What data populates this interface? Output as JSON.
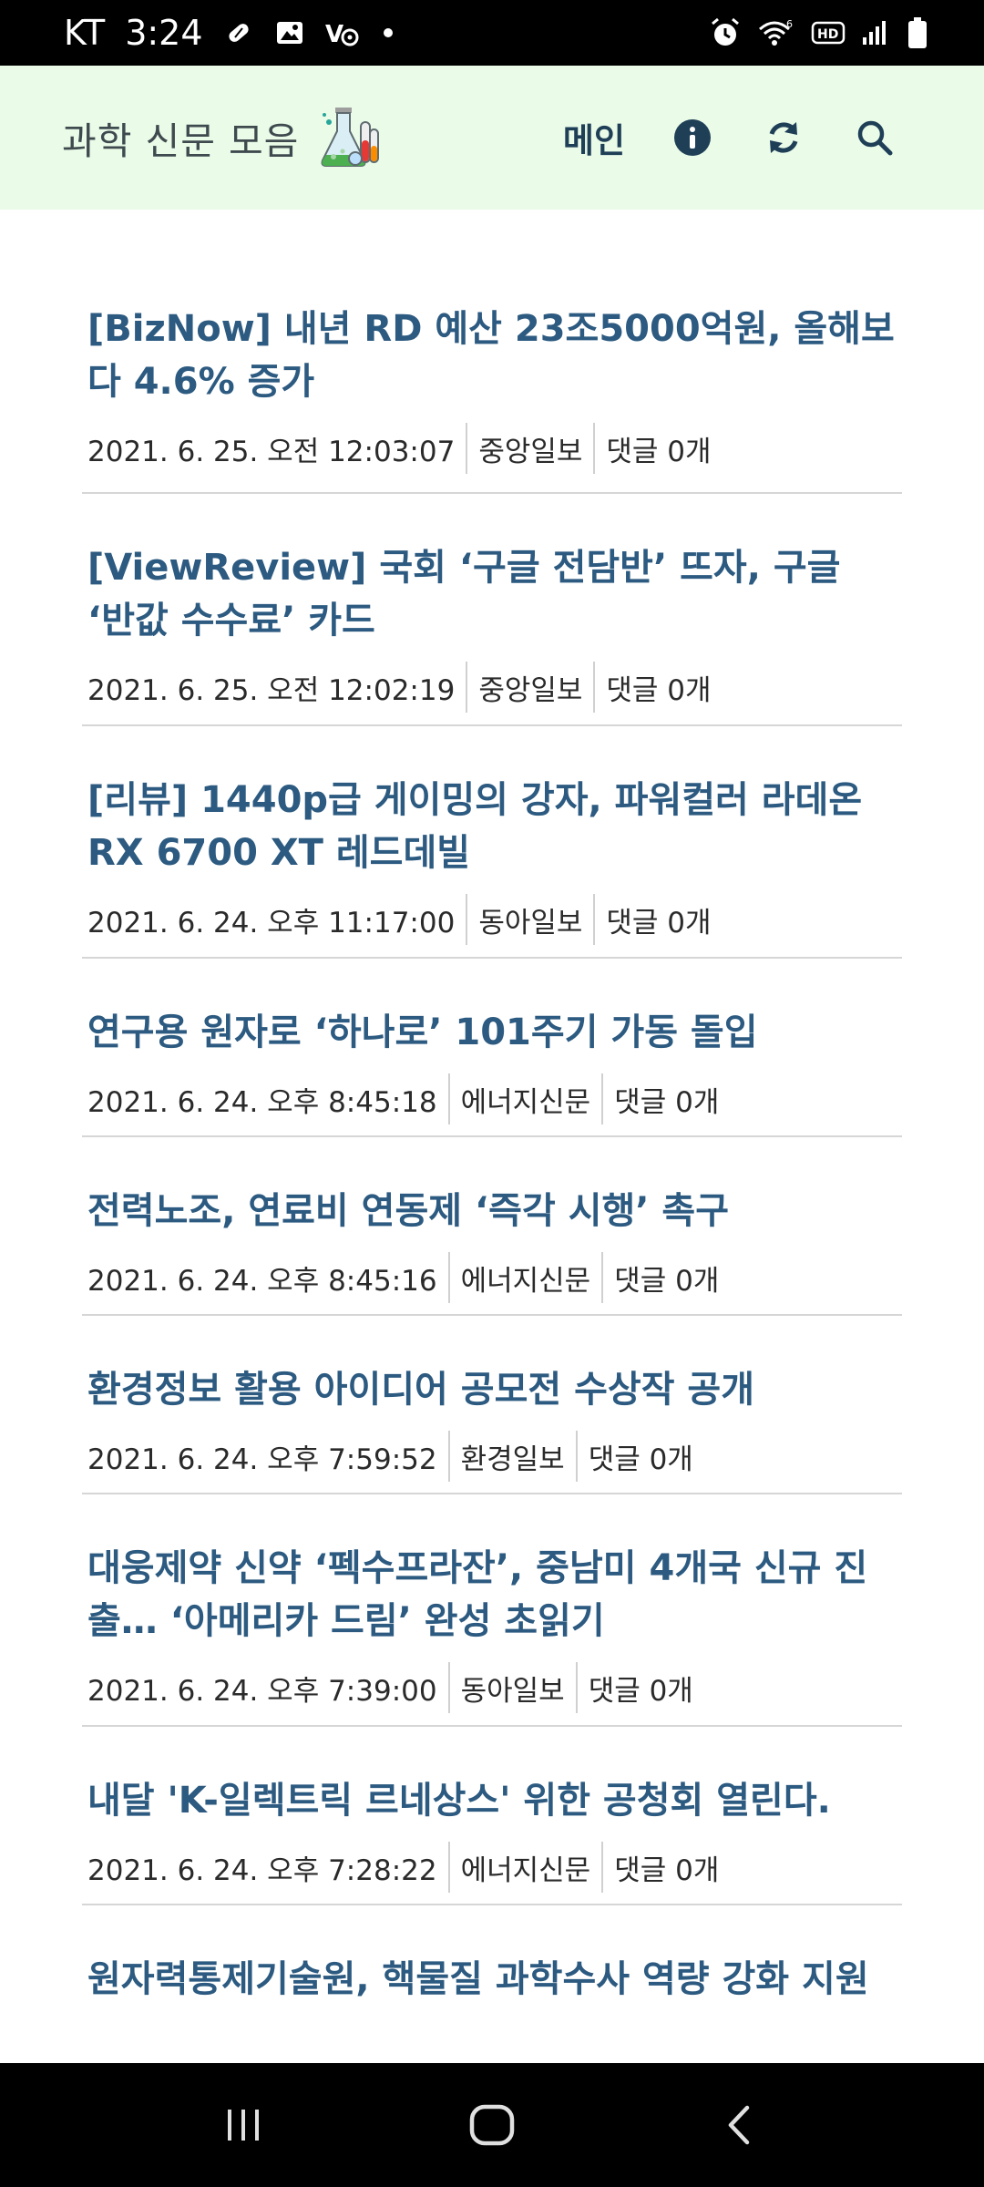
{
  "status_bar": {
    "carrier": "KT",
    "time": "3:24",
    "left_icons": [
      "pill-icon",
      "gallery-icon",
      "vpn-settings-icon",
      "dot-icon"
    ],
    "right_icons": [
      "alarm-icon",
      "wifi-6-icon",
      "hd-voice-icon",
      "signal-icon",
      "battery-icon"
    ]
  },
  "header": {
    "title": "과학 신문 모음",
    "logo_icon": "chemistry-flasks-icon",
    "menu_main": "메인",
    "actions": [
      "info-icon",
      "refresh-icon",
      "search-icon"
    ]
  },
  "colors": {
    "header_bg": "#eafbe8",
    "title_link": "#2c5a80",
    "menu_text": "#1f3f57",
    "divider": "#d6d6d6"
  },
  "news": [
    {
      "title": "[BizNow] 내년 RD 예산 23조5000억원, 올해보다 4.6% 증가",
      "date": "2021. 6. 25. 오전 12:03:07",
      "source": "중앙일보",
      "comments": "댓글 0개"
    },
    {
      "title": "[ViewReview] 국회 ‘구글 전담반’ 뜨자, 구글 ‘반값 수수료’ 카드",
      "date": "2021. 6. 25. 오전 12:02:19",
      "source": "중앙일보",
      "comments": "댓글 0개"
    },
    {
      "title": "[리뷰] 1440p급 게이밍의 강자, 파워컬러 라데온 RX 6700 XT 레드데빌",
      "date": "2021. 6. 24. 오후 11:17:00",
      "source": "동아일보",
      "comments": "댓글 0개"
    },
    {
      "title": "연구용 원자로 ‘하나로’ 101주기 가동 돌입",
      "date": "2021. 6. 24. 오후 8:45:18",
      "source": "에너지신문",
      "comments": "댓글 0개"
    },
    {
      "title": "전력노조, 연료비 연동제 ‘즉각 시행’ 촉구",
      "date": "2021. 6. 24. 오후 8:45:16",
      "source": "에너지신문",
      "comments": "댓글 0개"
    },
    {
      "title": "환경정보 활용 아이디어 공모전 수상작 공개",
      "date": "2021. 6. 24. 오후 7:59:52",
      "source": "환경일보",
      "comments": "댓글 0개"
    },
    {
      "title": "대웅제약 신약 ‘펙수프라잔’, 중남미 4개국 신규 진출… ‘아메리카 드림’ 완성 초읽기",
      "date": "2021. 6. 24. 오후 7:39:00",
      "source": "동아일보",
      "comments": "댓글 0개"
    },
    {
      "title": "내달 'K-일렉트릭 르네상스' 위한 공청회 열린다.",
      "date": "2021. 6. 24. 오후 7:28:22",
      "source": "에너지신문",
      "comments": "댓글 0개"
    },
    {
      "title": "원자력통제기술원, 핵물질 과학수사 역량 강화 지원"
    }
  ],
  "nav_bar": {
    "buttons": [
      "recent-apps-icon",
      "home-icon",
      "back-icon"
    ]
  }
}
